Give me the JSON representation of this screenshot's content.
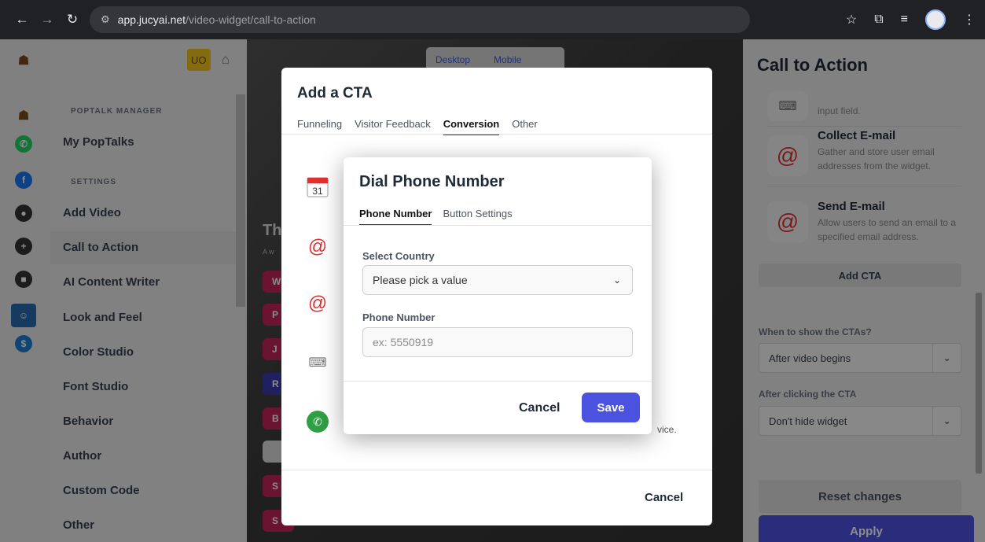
{
  "browser": {
    "url_host": "app.jucyai.net",
    "url_path": "/video-widget/call-to-action"
  },
  "sidebar": {
    "badge": "UO",
    "section_manager": "POPTALK MANAGER",
    "section_settings": "SETTINGS",
    "items": [
      {
        "label": "My PopTalks"
      },
      {
        "label": "Add Video"
      },
      {
        "label": "Call to Action"
      },
      {
        "label": "AI Content Writer"
      },
      {
        "label": "Look and Feel"
      },
      {
        "label": "Color Studio"
      },
      {
        "label": "Font Studio"
      },
      {
        "label": "Behavior"
      },
      {
        "label": "Author"
      },
      {
        "label": "Custom Code"
      },
      {
        "label": "Other"
      }
    ]
  },
  "preview": {
    "toggle_desktop": "Desktop",
    "toggle_mobile": "Mobile",
    "ghost_title": "Th",
    "ghost_sub": "A w",
    "pills": [
      "W",
      "P",
      "J",
      "R",
      "B",
      "",
      "S",
      "S"
    ]
  },
  "cta_modal": {
    "title": "Add a CTA",
    "tabs": [
      "Funneling",
      "Visitor Feedback",
      "Conversion",
      "Other"
    ],
    "active_tab": "Conversion",
    "cancel": "Cancel",
    "partial_text": "vice."
  },
  "dial_modal": {
    "title": "Dial Phone Number",
    "tabs": [
      "Phone Number",
      "Button Settings"
    ],
    "active_tab": "Phone Number",
    "country_label": "Select Country",
    "country_value": "Please pick a value",
    "phone_label": "Phone Number",
    "phone_placeholder": "ex: 5550919",
    "cancel": "Cancel",
    "save": "Save"
  },
  "right_panel": {
    "title": "Call to Action",
    "cards": [
      {
        "title": "",
        "desc": "input field.",
        "icon": "input-icon"
      },
      {
        "title": "Collect E-mail",
        "desc": "Gather and store user email addresses from the widget.",
        "icon": "at-icon"
      },
      {
        "title": "Send E-mail",
        "desc": "Allow users to send an email to a specified email address.",
        "icon": "at-icon"
      }
    ],
    "add_cta": "Add CTA",
    "when_label": "When to show the CTAs?",
    "when_value": "After video begins",
    "after_label": "After clicking the CTA",
    "after_value": "Don't hide widget",
    "reset": "Reset changes",
    "apply": "Apply"
  },
  "colors": {
    "accent": "#4c52e0",
    "badge": "#f5c21b",
    "at_icon": "#e03131"
  }
}
